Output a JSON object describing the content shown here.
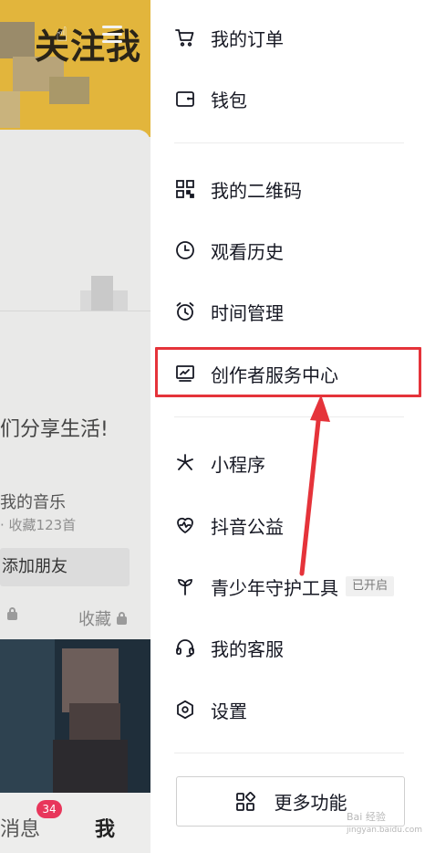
{
  "background_page": {
    "banner_text": "关注我",
    "slogan": "们分享生活!",
    "music_title": "我的音乐",
    "music_subtitle": "· 收藏123首",
    "add_friend_label": "添加朋友",
    "tab_favorites": "收藏",
    "nav_messages": "消息",
    "nav_messages_badge": "34",
    "nav_me": "我"
  },
  "drawer": {
    "menu": [
      {
        "label": "我的订单",
        "icon": "cart-icon"
      },
      {
        "label": "钱包",
        "icon": "wallet-icon"
      },
      {
        "label": "我的二维码",
        "icon": "qr-code-icon"
      },
      {
        "label": "观看历史",
        "icon": "clock-icon"
      },
      {
        "label": "时间管理",
        "icon": "alarm-clock-icon"
      },
      {
        "label": "创作者服务中心",
        "icon": "chart-monitor-icon"
      },
      {
        "label": "小程序",
        "icon": "asterisk-icon"
      },
      {
        "label": "抖音公益",
        "icon": "heart-pulse-icon"
      },
      {
        "label": "青少年守护工具",
        "icon": "sprout-icon",
        "status": "已开启"
      },
      {
        "label": "我的客服",
        "icon": "headset-icon"
      },
      {
        "label": "设置",
        "icon": "hexagon-gear-icon"
      }
    ],
    "more_button_label": "更多功能"
  },
  "annotation": {
    "highlighted_item": "创作者服务中心",
    "highlight_color": "#e5333a"
  },
  "watermark": {
    "text": "Bai 经验",
    "subtext": "jingyan.baidu.com"
  },
  "colors": {
    "banner": "#e2b53c",
    "badge": "#e8365b",
    "text_primary": "#161823"
  }
}
